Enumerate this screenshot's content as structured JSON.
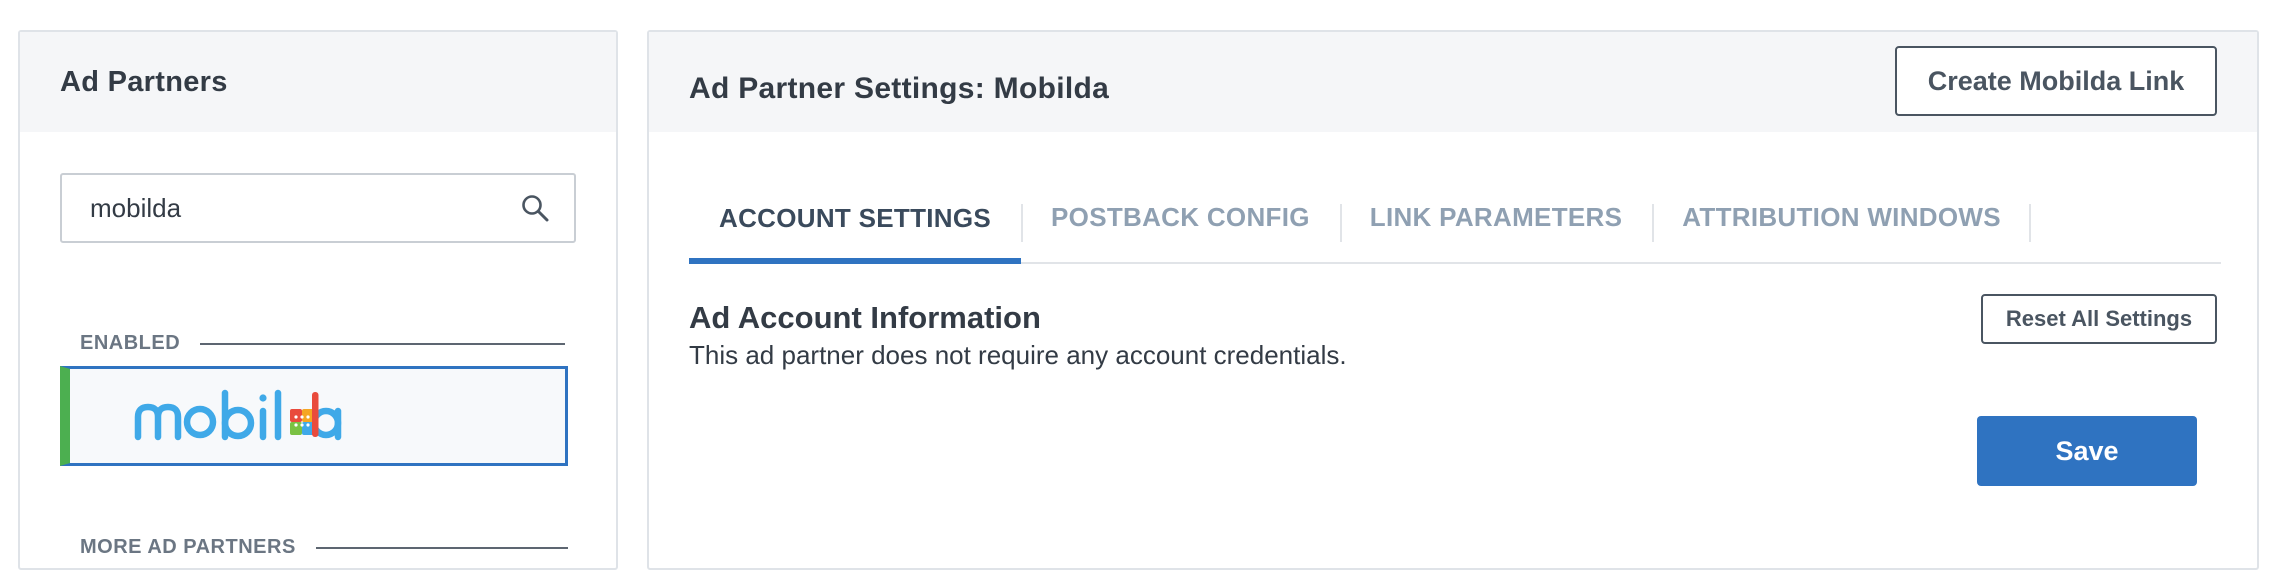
{
  "left_panel": {
    "title": "Ad Partners",
    "search": {
      "value": "mobilda",
      "icon": "search-icon"
    },
    "enabled_label": "ENABLED",
    "enabled_partners": [
      {
        "logo_text": "mobilda",
        "logo_colors": [
          "#3fa9e8",
          "#e94b3c",
          "#f5a623",
          "#7ac143"
        ]
      }
    ],
    "more_label": "MORE AD PARTNERS"
  },
  "right_panel": {
    "title": "Ad Partner Settings: Mobilda",
    "create_link_label": "Create Mobilda Link",
    "tabs": [
      {
        "label": "ACCOUNT SETTINGS",
        "active": true
      },
      {
        "label": "POSTBACK CONFIG",
        "active": false
      },
      {
        "label": "LINK PARAMETERS",
        "active": false
      },
      {
        "label": "ATTRIBUTION WINDOWS",
        "active": false
      }
    ],
    "section_heading": "Ad Account Information",
    "section_desc": "This ad partner does not require any account credentials.",
    "reset_label": "Reset All Settings",
    "save_label": "Save"
  },
  "colors": {
    "accent": "#2f73c1",
    "enabled_indicator": "#4caf50",
    "panel_header_bg": "#f5f6f8",
    "tab_inactive": "#8fa0b2"
  }
}
